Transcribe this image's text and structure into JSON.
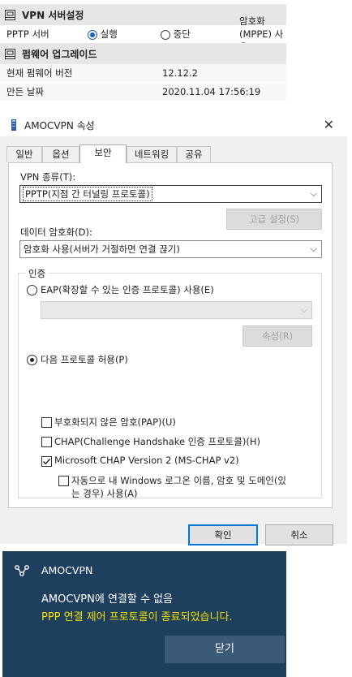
{
  "router": {
    "vpn_section_title": "VPN 서버설정",
    "pptp_label": "PPTP 서버",
    "run_option": "실행",
    "stop_option": "중단",
    "encryption_label": "암호화(MPPE) 사용",
    "selected": "실행",
    "firmware_section_title": "펌웨어 업그레이드",
    "current_version_label": "현재 펌웨어 버전",
    "current_version_value": "12.12.2",
    "build_date_label": "만든 날짜",
    "build_date_value": "2020.11.04 17:56:19"
  },
  "dialog": {
    "title": "AMOCVPN 속성",
    "tabs": [
      "일반",
      "옵션",
      "보안",
      "네트워킹",
      "공유"
    ],
    "active_tab": "보안",
    "vpn_type_label": "VPN 종류(T):",
    "vpn_type_value": "PPTP(지점 간 터널링 프로토콜)",
    "advanced_button": "고급 설정(S)",
    "data_encryption_label": "데이터 암호화(D):",
    "data_encryption_value": "암호화 사용(서버가 거절하면 연결 끊기)",
    "auth_group_label": "인증",
    "eap_option": "EAP(확장할 수 있는 인증 프로토콜) 사용(E)",
    "eap_select_value": "",
    "properties_button": "속성(R)",
    "allow_protocols_option": "다음 프로토콜 허용(P)",
    "pap_checkbox": "부호화되지 않은 암호(PAP)(U)",
    "chap_checkbox": "CHAP(Challenge Handshake 인증 프로토콜)(H)",
    "mschap_checkbox": "Microsoft CHAP Version 2 (MS-CHAP v2)",
    "auto_login_line1": "자동으로 내 Windows 로그온 이름, 암호 및 도메인(있",
    "auto_login_line2": "는 경우) 사용(A)",
    "ok_button": "확인",
    "cancel_button": "취소"
  },
  "toast": {
    "app_name": "AMOCVPN",
    "message": "AMOCVPN에 연결할 수 없음",
    "error": "PPP 연결 제어 프로토콜이 종료되었습니다.",
    "close_button": "닫기"
  },
  "colors": {
    "toast_bg": "#1f3f5f",
    "toast_error_text": "#f4e000",
    "accent": "#0078d7"
  }
}
